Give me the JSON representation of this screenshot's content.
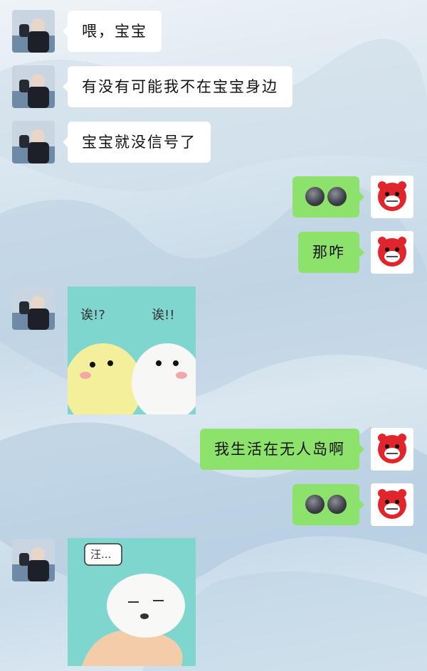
{
  "messages": [
    {
      "side": "left",
      "type": "text",
      "text": "喂，宝宝"
    },
    {
      "side": "left",
      "type": "text",
      "text": "有没有可能我不在宝宝身边"
    },
    {
      "side": "left",
      "type": "text",
      "text": "宝宝就没信号了"
    },
    {
      "side": "right",
      "type": "emoji",
      "emoji": "dark-moon-face-emoji x2"
    },
    {
      "side": "right",
      "type": "text",
      "text": "那咋"
    },
    {
      "side": "left",
      "type": "sticker",
      "caption_left": "诶!?",
      "caption_right": "诶!!"
    },
    {
      "side": "right",
      "type": "text",
      "text": "我生活在无人岛啊"
    },
    {
      "side": "right",
      "type": "emoji",
      "emoji": "dark-moon-face-emoji x2"
    },
    {
      "side": "left",
      "type": "sticker",
      "caption": "汪..."
    }
  ],
  "colors": {
    "sent_bubble": "#8de26b",
    "received_bubble": "#ffffff"
  }
}
